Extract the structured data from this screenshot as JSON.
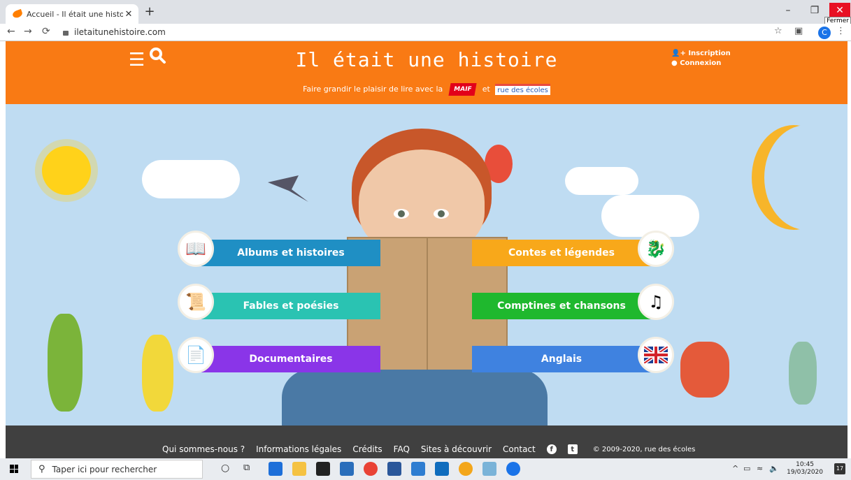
{
  "browser": {
    "tab_title": "Accueil - Il était une histoire - IE",
    "tab_close": "✕",
    "new_tab": "+",
    "url": "iletaitunehistoire.com",
    "minimize": "–",
    "restore": "❐",
    "close": "✕",
    "close_tooltip": "Fermer",
    "profile_initial": "C"
  },
  "header": {
    "title": "Il était une histoire",
    "inscription": "Inscription",
    "connexion": "Connexion",
    "tagline": "Faire grandir le plaisir de lire avec la",
    "maif": "MAIF",
    "et": "et",
    "rue_des_ecoles": "rue des écoles"
  },
  "categories": {
    "albums": "Albums et histoires",
    "fables": "Fables et poésies",
    "documentaires": "Documentaires",
    "contes": "Contes et légendes",
    "comptines": "Comptines et chansons",
    "anglais": "Anglais"
  },
  "colors": {
    "albums": "#1f8fc4",
    "fables": "#2ac3b2",
    "documentaires": "#8a35e8",
    "contes": "#f8a81a",
    "comptines": "#1fb82e",
    "anglais": "#3f82e0",
    "header": "#f97a14",
    "footer": "#404040"
  },
  "footer": {
    "links": [
      "Qui sommes-nous ?",
      "Informations légales",
      "Crédits",
      "FAQ",
      "Sites à découvrir",
      "Contact"
    ],
    "copyright": "© 2009-2020, rue des écoles"
  },
  "taskbar": {
    "search_placeholder": "Taper ici pour rechercher",
    "time": "10:45",
    "date": "19/03/2020",
    "notification_count": "17"
  }
}
